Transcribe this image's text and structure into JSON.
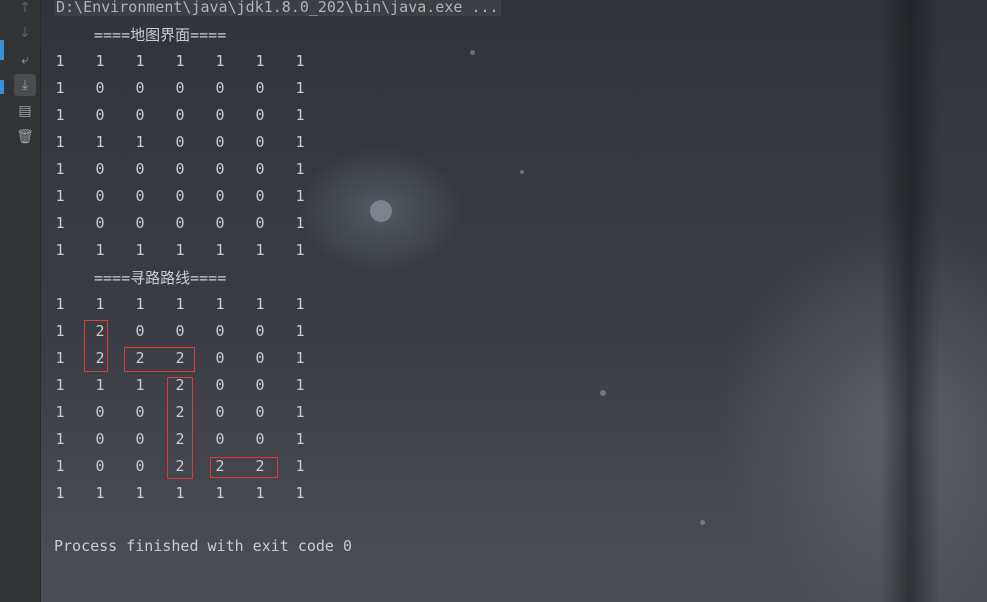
{
  "console": {
    "command_line": "D:\\Environment\\java\\jdk1.8.0_202\\bin\\java.exe ...",
    "map_heading": "====地图界面====",
    "map_grid": [
      [
        "1",
        "1",
        "1",
        "1",
        "1",
        "1",
        "1"
      ],
      [
        "1",
        "0",
        "0",
        "0",
        "0",
        "0",
        "1"
      ],
      [
        "1",
        "0",
        "0",
        "0",
        "0",
        "0",
        "1"
      ],
      [
        "1",
        "1",
        "1",
        "0",
        "0",
        "0",
        "1"
      ],
      [
        "1",
        "0",
        "0",
        "0",
        "0",
        "0",
        "1"
      ],
      [
        "1",
        "0",
        "0",
        "0",
        "0",
        "0",
        "1"
      ],
      [
        "1",
        "0",
        "0",
        "0",
        "0",
        "0",
        "1"
      ],
      [
        "1",
        "1",
        "1",
        "1",
        "1",
        "1",
        "1"
      ]
    ],
    "route_heading": "====寻路路线====",
    "route_grid": [
      [
        "1",
        "1",
        "1",
        "1",
        "1",
        "1",
        "1"
      ],
      [
        "1",
        "2",
        "0",
        "0",
        "0",
        "0",
        "1"
      ],
      [
        "1",
        "2",
        "2",
        "2",
        "0",
        "0",
        "1"
      ],
      [
        "1",
        "1",
        "1",
        "2",
        "0",
        "0",
        "1"
      ],
      [
        "1",
        "0",
        "0",
        "2",
        "0",
        "0",
        "1"
      ],
      [
        "1",
        "0",
        "0",
        "2",
        "0",
        "0",
        "1"
      ],
      [
        "1",
        "0",
        "0",
        "2",
        "2",
        "2",
        "1"
      ],
      [
        "1",
        "1",
        "1",
        "1",
        "1",
        "1",
        "1"
      ]
    ],
    "finish_message": "Process finished with exit code 0"
  },
  "toolbar": {
    "icons": [
      "up-arrow-icon",
      "down-arrow-icon",
      "soft-wrap-icon",
      "scroll-to-end-icon",
      "print-icon",
      "trash-icon"
    ]
  },
  "colors": {
    "highlight": "#e0393b",
    "text": "#c9ccd0",
    "accent": "#3d8fd1"
  }
}
